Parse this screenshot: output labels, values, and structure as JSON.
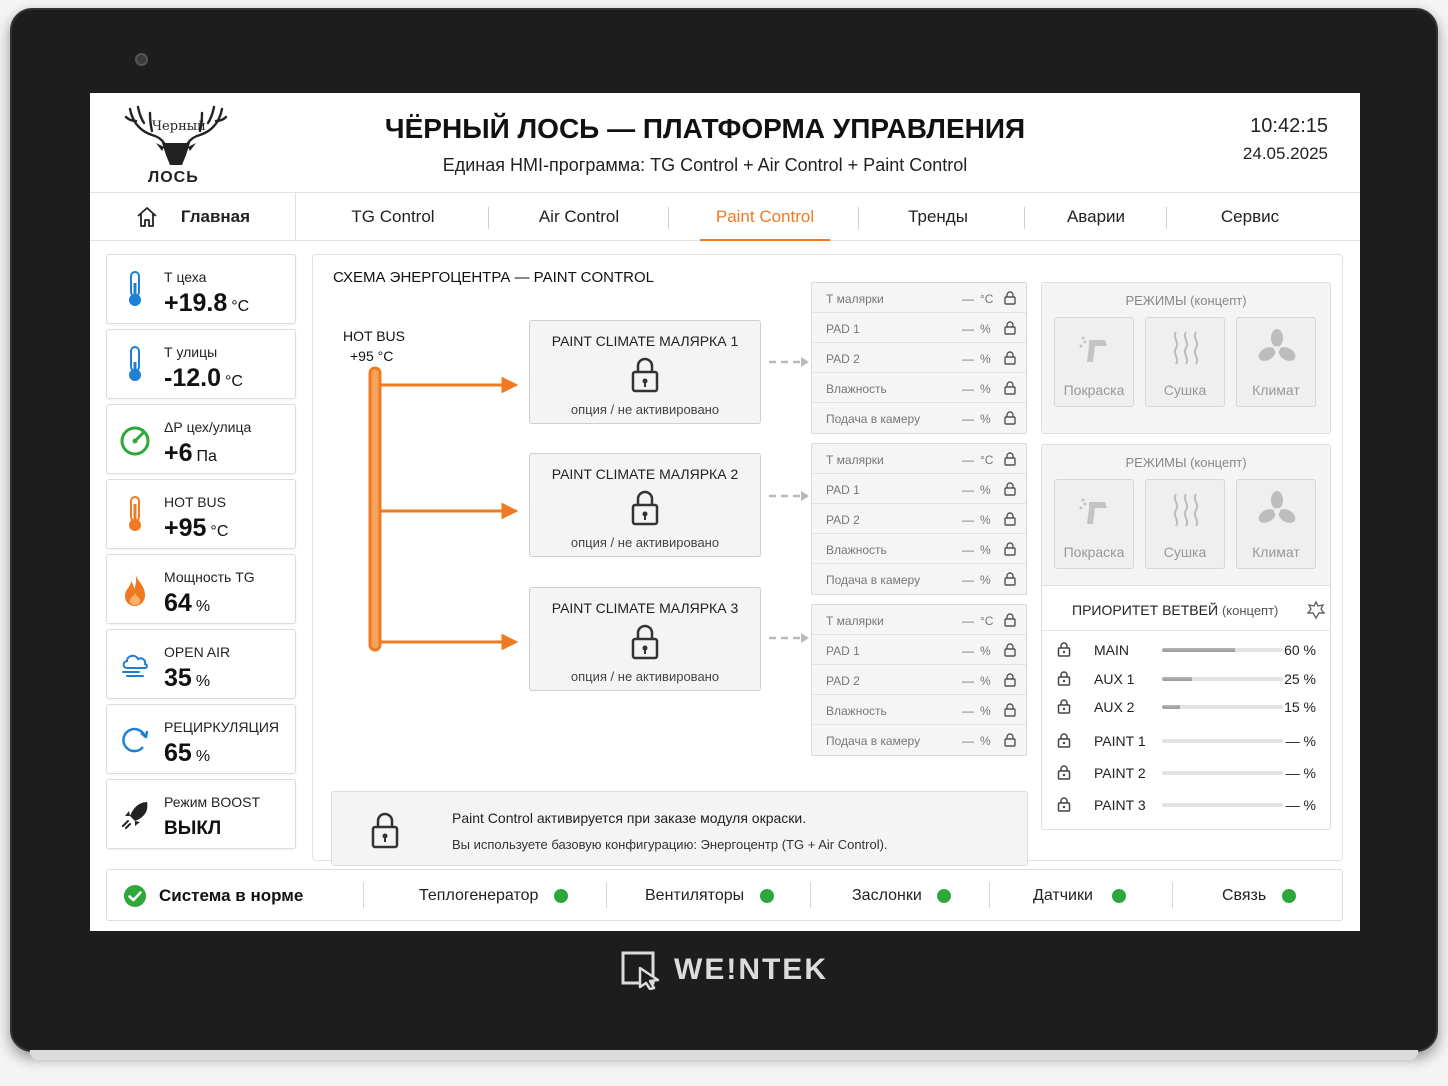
{
  "header": {
    "logo_top": "Черный",
    "logo_bottom": "ЛОСЬ",
    "title": "ЧЁРНЫЙ ЛОСЬ — ПЛАТФОРМА УПРАВЛЕНИЯ",
    "subtitle": "Единая HMI-программа: TG Control + Air Control + Paint Control",
    "time": "10:42:15",
    "date": "24.05.2025"
  },
  "tabs": {
    "home": "Главная",
    "items": [
      "TG Control",
      "Air Control",
      "Paint Control",
      "Тренды",
      "Аварии",
      "Сервис"
    ],
    "active": "Paint Control"
  },
  "metrics": [
    {
      "icon": "thermometer-blue-icon",
      "label": "Т цеха",
      "value": "+19.8",
      "unit": "°C"
    },
    {
      "icon": "thermometer-blue-icon",
      "label": "Т улицы",
      "value": "-12.0",
      "unit": "°C"
    },
    {
      "icon": "gauge-icon",
      "label": "ΔР цех/улица",
      "value": "+6",
      "unit": "Па"
    },
    {
      "icon": "thermometer-orange-icon",
      "label": "HOT BUS",
      "value": "+95",
      "unit": "°C"
    },
    {
      "icon": "flame-icon",
      "label": "Мощность TG",
      "value": "64",
      "unit": "%"
    },
    {
      "icon": "wind-cloud-icon",
      "label": "OPEN AIR",
      "value": "35",
      "unit": "%"
    },
    {
      "icon": "recirculation-icon",
      "label": "РЕЦИРКУЛЯЦИЯ",
      "value": "65",
      "unit": "%"
    },
    {
      "icon": "rocket-icon",
      "label": "Режим BOOST",
      "value": "ВЫКЛ",
      "unit": ""
    }
  ],
  "scheme": {
    "title": "СХЕМА ЭНЕРГОЦЕНТРА  —  PAINT CONTROL",
    "bus_label": "HOT BUS",
    "bus_temp": "+95 °C",
    "climates": [
      {
        "title": "PAINT CLIMATE МАЛЯРКА 1",
        "status": "опция / не активировано"
      },
      {
        "title": "PAINT CLIMATE МАЛЯРКА 2",
        "status": "опция / не активировано"
      },
      {
        "title": "PAINT CLIMATE МАЛЯРКА 3",
        "status": "опция / не активировано"
      }
    ],
    "params": [
      {
        "label": "Т малярки",
        "value": "—",
        "unit": "°C"
      },
      {
        "label": "PAD 1",
        "value": "—",
        "unit": "%"
      },
      {
        "label": "PAD 2",
        "value": "—",
        "unit": "%"
      },
      {
        "label": "Влажность",
        "value": "—",
        "unit": "%"
      },
      {
        "label": "Подача в камеру",
        "value": "—",
        "unit": "%"
      }
    ],
    "modes": {
      "title": "РЕЖИМЫ (концепт)",
      "buttons": [
        {
          "icon": "spray-gun-icon",
          "label": "Покраска"
        },
        {
          "icon": "heat-waves-icon",
          "label": "Сушка"
        },
        {
          "icon": "fan-icon",
          "label": "Климат"
        }
      ]
    },
    "priority": {
      "title": "ПРИОРИТЕТ ВЕТВЕЙ",
      "title_note": "(концепт)",
      "rows": [
        {
          "name": "MAIN",
          "value": "60 %",
          "fill": 0.6
        },
        {
          "name": "AUX 1",
          "value": "25 %",
          "fill": 0.25
        },
        {
          "name": "AUX 2",
          "value": "15 %",
          "fill": 0.15
        },
        {
          "name": "PAINT 1",
          "value": "— %",
          "fill": 0
        },
        {
          "name": "PAINT 2",
          "value": "— %",
          "fill": 0
        },
        {
          "name": "PAINT 3",
          "value": "— %",
          "fill": 0
        }
      ]
    },
    "note": {
      "line1": "Paint Control активируется при заказе модуля окраски.",
      "line2": "Вы используете базовую конфигурацию: Энергоцентр (TG + Air Control)."
    }
  },
  "status": {
    "ok_label": "Система в норме",
    "items": [
      "Теплогенератор",
      "Вентиляторы",
      "Заслонки",
      "Датчики",
      "Связь"
    ],
    "ok_color": "#2ea83b"
  },
  "device_brand": "WE!NTEK",
  "colors": {
    "accent": "#ef7a22",
    "ok": "#2ea83b"
  }
}
